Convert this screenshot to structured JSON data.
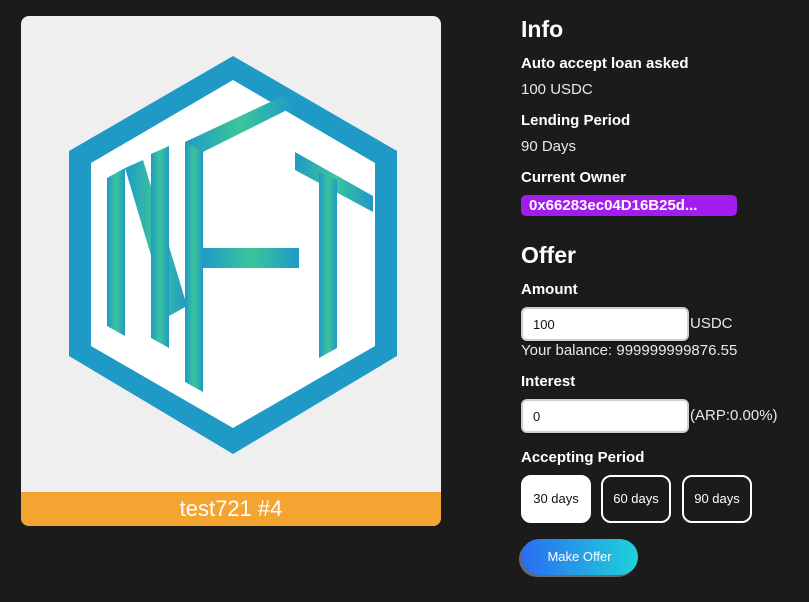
{
  "nft": {
    "logo_letters": "NFT",
    "caption": "test721 #4"
  },
  "info": {
    "title": "Info",
    "auto_accept_label": "Auto accept loan asked",
    "auto_accept_value": "100 USDC",
    "lending_period_label": "Lending Period",
    "lending_period_value": "90 Days",
    "owner_label": "Current Owner",
    "owner_value": "0x66283ec04D16B25d..."
  },
  "offer": {
    "title": "Offer",
    "amount_label": "Amount",
    "amount_value": "100",
    "amount_suffix": "USDC",
    "balance_text": "Your balance: 999999999876.55",
    "interest_label": "Interest",
    "interest_value": "0",
    "interest_suffix": "(ARP:0.00%)",
    "period_label": "Accepting Period",
    "periods": [
      "30 days",
      "60 days",
      "90 days"
    ],
    "selected_period": "30 days",
    "submit_label": "Make Offer"
  },
  "colors": {
    "background": "#1b1b1b",
    "caption_bar": "#f4a431",
    "owner_pill": "#a21cf0",
    "logo_blue": "#1f9ac7",
    "logo_green": "#3cc59a"
  }
}
